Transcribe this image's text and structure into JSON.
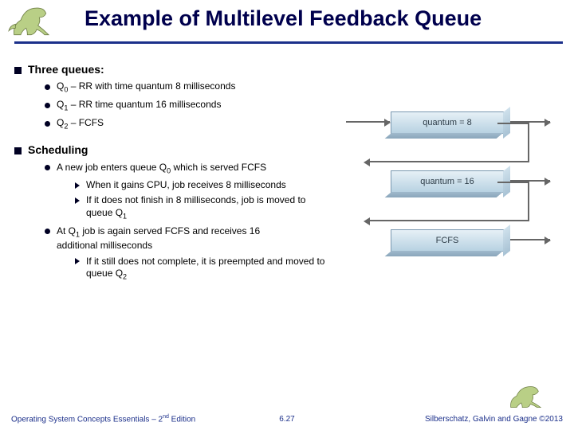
{
  "title": "Example of Multilevel Feedback Queue",
  "section1": {
    "heading": "Three queues:",
    "q0_a": "Q",
    "q0_s": "0",
    "q0_b": " – RR with time quantum 8 milliseconds",
    "q1_a": "Q",
    "q1_s": "1",
    "q1_b": " – RR time quantum 16 milliseconds",
    "q2_a": "Q",
    "q2_s": "2",
    "q2_b": " – FCFS"
  },
  "section2": {
    "heading": "Scheduling",
    "p1_a": "A new job enters queue Q",
    "p1_s": "0",
    "p1_b": " which is served FCFS",
    "p1_1": "When it gains CPU, job receives 8 milliseconds",
    "p1_2_a": "If it does not finish in 8 milliseconds, job is moved to queue Q",
    "p1_2_s": "1",
    "p2_a": "At Q",
    "p2_s": "1",
    "p2_b": " job is again served FCFS and receives 16 additional milliseconds",
    "p2_1_a": "If it still does not complete, it is preempted and moved to queue Q",
    "p2_1_s": "2"
  },
  "diagram": {
    "box1": "quantum = 8",
    "box2": "quantum = 16",
    "box3": "FCFS"
  },
  "footer": {
    "left_a": "Operating System Concepts Essentials – 2",
    "left_sup": "nd",
    "left_b": " Edition",
    "center": "6.27",
    "right": "Silberschatz, Galvin and Gagne ©2013"
  }
}
